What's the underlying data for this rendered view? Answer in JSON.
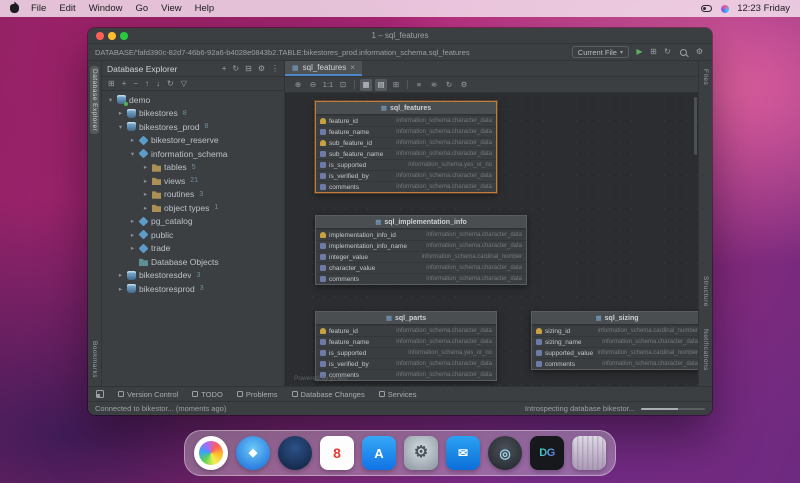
{
  "menubar": {
    "items": [
      "File",
      "Edit",
      "Window",
      "Go",
      "View",
      "Help"
    ],
    "clock": "12:23 Friday"
  },
  "window": {
    "title": "1 – sql_features"
  },
  "pathbar": {
    "path": "DATABASE/'fafd390c-82d7-46b6-92a6-b4028e0843b2.TABLE:bikestores_prod.information_schema.sql_features",
    "scope_label": "Current File",
    "actions": [
      {
        "glyph": "▶",
        "cls": "run"
      },
      {
        "glyph": "⊞"
      },
      {
        "glyph": "↻"
      }
    ],
    "settings_glyph": "⚙"
  },
  "left_strip": {
    "top": "Database Explorer",
    "bottom": "Bookmarks"
  },
  "right_strip": {
    "top": "Files",
    "mid": "Structure",
    "bottom": "Notifications"
  },
  "explorer": {
    "title": "Database Explorer",
    "header_icons": [
      {
        "glyph": "+"
      },
      {
        "glyph": "↻"
      },
      {
        "glyph": "⊟"
      },
      {
        "glyph": "⚙"
      },
      {
        "glyph": "⋮"
      }
    ],
    "toolbar_icons": [
      {
        "glyph": "⊞"
      },
      {
        "glyph": "+"
      },
      {
        "glyph": "−"
      },
      {
        "glyph": "↑"
      },
      {
        "glyph": "↓"
      },
      {
        "glyph": "↻"
      },
      {
        "glyph": "▽"
      }
    ],
    "tree": [
      {
        "label": "demo",
        "count": "",
        "cls": "lv0 open i-conn"
      },
      {
        "label": "bikestores",
        "count": "8",
        "cls": "lv1 closed i-db"
      },
      {
        "label": "bikestores_prod",
        "count": "8",
        "cls": "lv1 open i-db"
      },
      {
        "label": "bikestore_reserve",
        "count": "",
        "cls": "lv2 closed i-schema"
      },
      {
        "label": "information_schema",
        "count": "",
        "cls": "lv2 open i-schema"
      },
      {
        "label": "tables",
        "count": "5",
        "cls": "lv3 closed i-fold"
      },
      {
        "label": "views",
        "count": "21",
        "cls": "lv3 closed i-fold"
      },
      {
        "label": "routines",
        "count": "3",
        "cls": "lv3 closed i-fold"
      },
      {
        "label": "object types",
        "count": "1",
        "cls": "lv3 closed i-fold"
      },
      {
        "label": "pg_catalog",
        "count": "",
        "cls": "lv2 closed i-schema"
      },
      {
        "label": "public",
        "count": "",
        "cls": "lv2 closed i-schema"
      },
      {
        "label": "trade",
        "count": "",
        "cls": "lv2 closed i-schema"
      },
      {
        "label": "Database Objects",
        "count": "",
        "cls": "lv2 none i-objs"
      },
      {
        "label": "bikestoresdev",
        "count": "3",
        "cls": "lv1 closed i-db"
      },
      {
        "label": "bikestoresprod",
        "count": "3",
        "cls": "lv1 closed i-db"
      }
    ]
  },
  "editor": {
    "tab": "sql_features",
    "powered": "Powered by yFiles",
    "toolbar_icons": [
      {
        "glyph": "⊕"
      },
      {
        "glyph": "⊖"
      },
      {
        "glyph": "1:1"
      },
      {
        "glyph": "⊡"
      },
      {
        "cls": "sep"
      },
      {
        "glyph": "▦",
        "cls": "active"
      },
      {
        "glyph": "▤",
        "cls": "active"
      },
      {
        "glyph": "⊞"
      },
      {
        "cls": "sep"
      },
      {
        "glyph": "≡"
      },
      {
        "glyph": "≋"
      },
      {
        "glyph": "↻"
      },
      {
        "glyph": "⚙"
      }
    ]
  },
  "diagram": {
    "tables": [
      {
        "name": "sql_features",
        "columns": [
          {
            "name": "feature_id",
            "type": "information_schema.character_data",
            "icon": "key"
          },
          {
            "name": "feature_name",
            "type": "information_schema.character_data",
            "icon": "col"
          },
          {
            "name": "sub_feature_id",
            "type": "information_schema.character_data",
            "icon": "key"
          },
          {
            "name": "sub_feature_name",
            "type": "information_schema.character_data",
            "icon": "col"
          },
          {
            "name": "is_supported",
            "type": "information_schema.yes_or_no",
            "icon": "col"
          },
          {
            "name": "is_verified_by",
            "type": "information_schema.character_data",
            "icon": "col"
          },
          {
            "name": "comments",
            "type": "information_schema.character_data",
            "icon": "col"
          }
        ]
      },
      {
        "name": "sql_implementation_info",
        "columns": [
          {
            "name": "implementation_info_id",
            "type": "information_schema.character_data",
            "icon": "key"
          },
          {
            "name": "implementation_info_name",
            "type": "information_schema.character_data",
            "icon": "col"
          },
          {
            "name": "integer_value",
            "type": "information_schema.cardinal_number",
            "icon": "col"
          },
          {
            "name": "character_value",
            "type": "information_schema.character_data",
            "icon": "col"
          },
          {
            "name": "comments",
            "type": "information_schema.character_data",
            "icon": "col"
          }
        ]
      },
      {
        "name": "sql_parts",
        "columns": [
          {
            "name": "feature_id",
            "type": "information_schema.character_data",
            "icon": "key"
          },
          {
            "name": "feature_name",
            "type": "information_schema.character_data",
            "icon": "col"
          },
          {
            "name": "is_supported",
            "type": "information_schema.yes_or_no",
            "icon": "col"
          },
          {
            "name": "is_verified_by",
            "type": "information_schema.character_data",
            "icon": "col"
          },
          {
            "name": "comments",
            "type": "information_schema.character_data",
            "icon": "col"
          }
        ]
      },
      {
        "name": "sql_sizing",
        "columns": [
          {
            "name": "sizing_id",
            "type": "information_schema.cardinal_number",
            "icon": "key"
          },
          {
            "name": "sizing_name",
            "type": "information_schema.character_data",
            "icon": "col"
          },
          {
            "name": "supported_value",
            "type": "information_schema.cardinal_number",
            "icon": "col"
          },
          {
            "name": "comments",
            "type": "information_schema.character_data",
            "icon": "col"
          }
        ]
      }
    ]
  },
  "panelbar": {
    "items": [
      {
        "label": "Version Control"
      },
      {
        "label": "TODO"
      },
      {
        "label": "Problems"
      },
      {
        "label": "Database Changes"
      },
      {
        "label": "Services"
      }
    ]
  },
  "statusbar": {
    "left": "Connected to bikestor... (moments ago)",
    "right": "Introspecting database bikestor..."
  },
  "dock": {
    "items": [
      {
        "name": "Photos",
        "glyph": "",
        "cls": "d-photos"
      },
      {
        "name": "Safari",
        "glyph": "◆",
        "cls": "d-safari"
      },
      {
        "name": "App",
        "glyph": "",
        "cls": "d-navy"
      },
      {
        "name": "Calendar",
        "glyph": "8",
        "cls": "d-cal"
      },
      {
        "name": "App Store",
        "glyph": "A",
        "cls": "d-store"
      },
      {
        "name": "System Settings",
        "glyph": "⚙",
        "cls": "d-set"
      },
      {
        "name": "Mail",
        "glyph": "✉",
        "cls": "d-mail"
      },
      {
        "name": "Photo Booth",
        "glyph": "◎",
        "cls": "d-cam"
      },
      {
        "name": "DataGrip",
        "glyph": "DG",
        "cls": "d-dg"
      },
      {
        "name": "Trash",
        "glyph": "",
        "cls": "d-trash"
      }
    ]
  }
}
